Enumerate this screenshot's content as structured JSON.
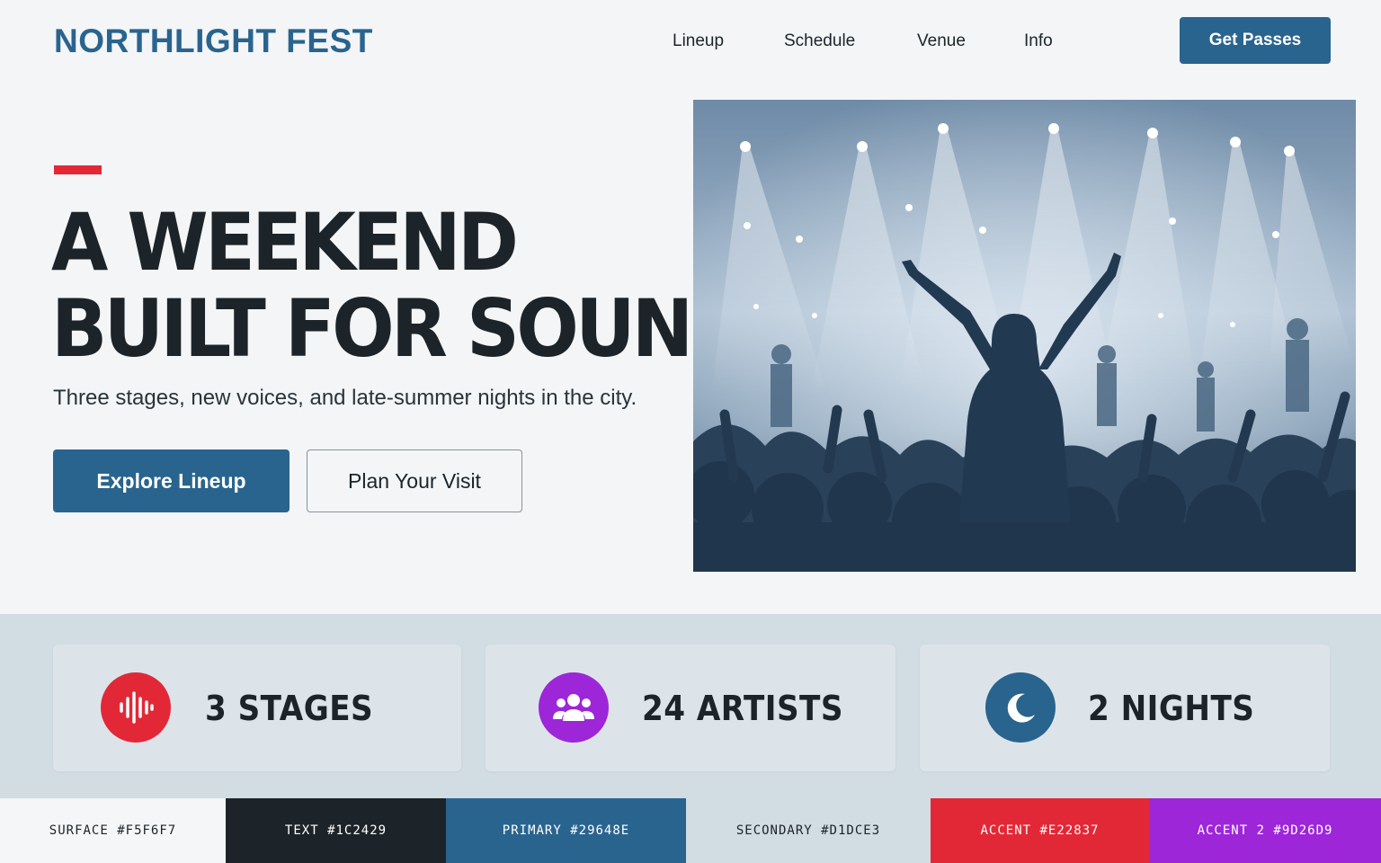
{
  "brand": {
    "name": "NORTHLIGHT FEST"
  },
  "nav": {
    "items": [
      {
        "label": "Lineup"
      },
      {
        "label": "Schedule"
      },
      {
        "label": "Venue"
      },
      {
        "label": "Info"
      }
    ],
    "cta_label": "Get Passes"
  },
  "hero": {
    "headline_line1": "A WEEKEND",
    "headline_line2": "BUILT FOR SOUND",
    "subhead": "Three stages, new voices, and late-summer nights in the city.",
    "primary_button": "Explore Lineup",
    "secondary_button": "Plan Your Visit",
    "image_icon": "concert-crowd-photo"
  },
  "stats": [
    {
      "label": "3 STAGES",
      "icon": "soundwave-icon",
      "color": "#E22837"
    },
    {
      "label": "24 ARTISTS",
      "icon": "people-group-icon",
      "color": "#9D26D9"
    },
    {
      "label": "2 NIGHTS",
      "icon": "moon-icon",
      "color": "#29648E"
    }
  ],
  "palette": [
    {
      "name": "SURFACE",
      "hex": "#F5F6F7",
      "label": "SURFACE  #F5F6F7",
      "text_color": "#1C2429"
    },
    {
      "name": "TEXT",
      "hex": "#1C2429",
      "label": "TEXT  #1C2429",
      "text_color": "#FFFFFF"
    },
    {
      "name": "PRIMARY",
      "hex": "#29648E",
      "label": "PRIMARY  #29648E",
      "text_color": "#FFFFFF"
    },
    {
      "name": "SECONDARY",
      "hex": "#D1DCE3",
      "label": "SECONDARY  #D1DCE3",
      "text_color": "#1C2429"
    },
    {
      "name": "ACCENT",
      "hex": "#E22837",
      "label": "ACCENT  #E22837",
      "text_color": "#FFFFFF"
    },
    {
      "name": "ACCENT 2",
      "hex": "#9D26D9",
      "label": "ACCENT 2  #9D26D9",
      "text_color": "#FFFFFF"
    }
  ]
}
